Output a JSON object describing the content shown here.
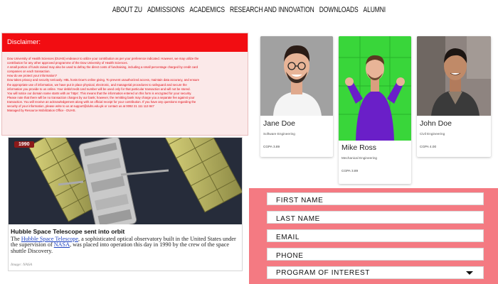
{
  "nav": [
    "ABOUT ZU",
    "ADMISSIONS",
    "ACADEMICS",
    "RESEARCH AND INNOVATION",
    "DOWNLOADS",
    "ALUMNI"
  ],
  "disclaimer": {
    "heading": "Disclaimer:",
    "lines": [
      "Dow University of Health Sciences (DUHS) endeavor to utilize your contribution as per your preference indicated. However, we may utilize the",
      "contribution for any other approved programme of the Dow University of Health Sciences.",
      "A small portion of funds raised may also be used to defray the direct costs of fundraising, including a small percentage charged by credit card",
      "companies on each transaction.",
      "How do we protect your information?",
      "Dow takes privacy and security seriously. HBL hosts Dow's online giving. To prevent unauthorized access, maintain data accuracy, and ensure",
      "the appropriate use of information, we have put in place physical, electronic, and managerial procedures to safeguard and secure the",
      "information you provide to us online. Your debit/credit card number will be used only for that particular transaction and will not be stored.",
      "You will notice our domain name starts with an 'https'. This means that the information entered on this form is encrypted for your security.",
      "Please note that there will be no transaction charges by our bank; however, the remitting bank may charge you a separate fee against your",
      "transaction. You will receive an acknowledgement along with an official receipt for your contribution. If you have any questions regarding the",
      "security of your information, please write to us at support@duhs.edu.pk or contact us at 0092 21 111 113 847"
    ],
    "footer": "Managed by Resource Mobilization Office - DUHS."
  },
  "news": {
    "year": "1990",
    "title": "Hubble Space Telescope sent into orbit",
    "text_pre": "The ",
    "link1": "Hubble Space Telescope",
    "text_mid": ", a sophisticated optical observatory built in the United States under the supervision of ",
    "link2": "NASA",
    "text_post": ", was placed into operation this day in 1990 by the crew of the space shuttle Discovery.",
    "credit": "Image: NASA"
  },
  "profiles": [
    {
      "name": "Jane Doe",
      "role": "Software Engineering",
      "gpa": "CGPA 3.89",
      "bg": "#a1a1a1"
    },
    {
      "name": "Mike Ross",
      "role": "Mechanical Engineering",
      "gpa": "CGPA 3.89",
      "bg": "#39d63a"
    },
    {
      "name": "John Doe",
      "role": "Civil Engineering",
      "gpa": "CGPA 4.00",
      "bg": "#8e8480"
    }
  ],
  "form": {
    "first_name": "FIRST NAME",
    "last_name": "LAST NAME",
    "email": "EMAIL",
    "phone": "PHONE",
    "program": "PROGRAM OF INTEREST"
  },
  "colors": {
    "red": "#f20d12",
    "salmon": "#f47a82",
    "disclaimer_text": "#e10b14"
  }
}
